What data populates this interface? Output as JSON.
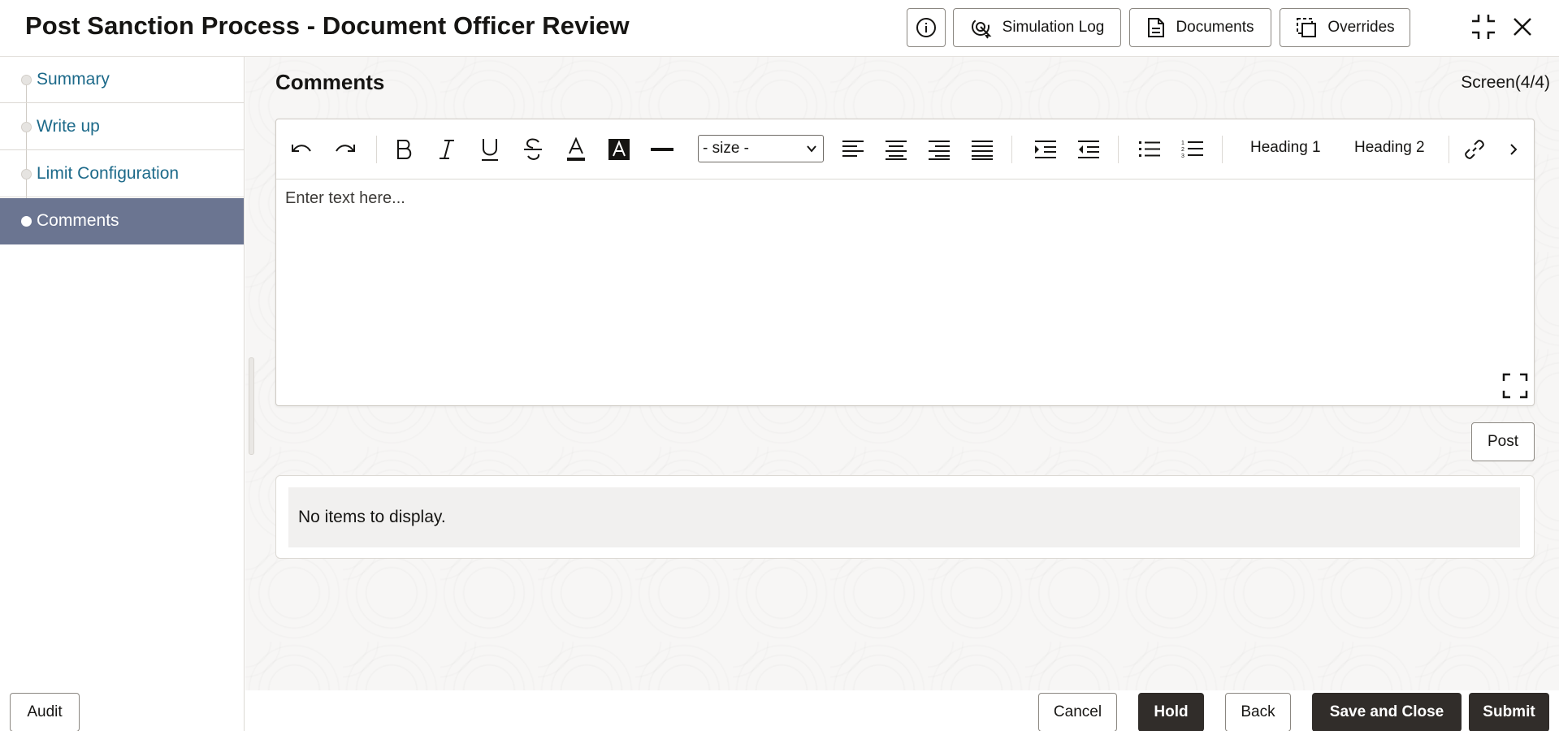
{
  "header": {
    "title": "Post Sanction Process - Document Officer Review",
    "buttons": {
      "info_icon": "info-icon",
      "simulation_log": "Simulation Log",
      "documents": "Documents",
      "overrides": "Overrides"
    },
    "icons": [
      "collapse-icon",
      "close-icon"
    ]
  },
  "sidebar": {
    "items": [
      {
        "label": "Summary",
        "active": false
      },
      {
        "label": "Write up",
        "active": false
      },
      {
        "label": "Limit Configuration",
        "active": false
      },
      {
        "label": "Comments",
        "active": true
      }
    ],
    "audit_label": "Audit"
  },
  "main": {
    "section_title": "Comments",
    "screen_indicator": "Screen(4/4)",
    "editor": {
      "size_select_value": "- size -",
      "heading1": "Heading 1",
      "heading2": "Heading 2",
      "placeholder": "Enter text here..."
    },
    "post_label": "Post",
    "empty_message": "No items to display."
  },
  "footer": {
    "cancel": "Cancel",
    "hold": "Hold",
    "back": "Back",
    "save_and_close": "Save and Close",
    "submit": "Submit"
  },
  "colors": {
    "active_nav": "#6b7591",
    "link_text": "#1d6a8a",
    "primary_button": "#312d2a"
  }
}
